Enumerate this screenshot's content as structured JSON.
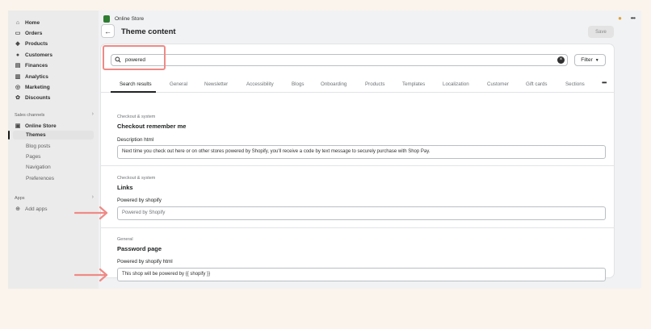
{
  "sidebar": {
    "items": [
      {
        "label": "Home",
        "icon": "home-icon"
      },
      {
        "label": "Orders",
        "icon": "inbox-icon"
      },
      {
        "label": "Products",
        "icon": "tag-icon"
      },
      {
        "label": "Customers",
        "icon": "person-icon"
      },
      {
        "label": "Finances",
        "icon": "bank-icon"
      },
      {
        "label": "Analytics",
        "icon": "chart-icon"
      },
      {
        "label": "Marketing",
        "icon": "target-icon"
      },
      {
        "label": "Discounts",
        "icon": "discount-icon"
      }
    ],
    "sales_channels_label": "Sales channels",
    "online_store_label": "Online Store",
    "online_store_subitems": [
      "Themes",
      "Blog posts",
      "Pages",
      "Navigation",
      "Preferences"
    ],
    "apps_label": "Apps",
    "add_apps_label": "Add apps"
  },
  "topbar": {
    "title": "Online Store"
  },
  "header": {
    "title": "Theme content",
    "save_label": "Save"
  },
  "search": {
    "value": "powered",
    "filter_label": "Filter"
  },
  "tabs": [
    "Search results",
    "General",
    "Newsletter",
    "Accessibility",
    "Blogs",
    "Onboarding",
    "Products",
    "Templates",
    "Localization",
    "Customer",
    "Gift cards",
    "Sections"
  ],
  "sections": [
    {
      "category": "Checkout & system",
      "title": "Checkout remember me",
      "field_label": "Description html",
      "field_value": "Next time you check out here or on other stores powered by Shopify, you'll receive a code by text message to securely purchase with Shop Pay."
    },
    {
      "category": "Checkout & system",
      "title": "Links",
      "field_label": "Powered by shopify",
      "field_value": "Powered by Shopify"
    },
    {
      "category": "General",
      "title": "Password page",
      "field_label": "Powered by shopify html",
      "field_value": "This shop will be powered by {{ shopify }}"
    }
  ],
  "colors": {
    "highlight": "#ef8a86",
    "page_bg": "#fbf4ec",
    "accent_logo": "#2e7d32"
  }
}
